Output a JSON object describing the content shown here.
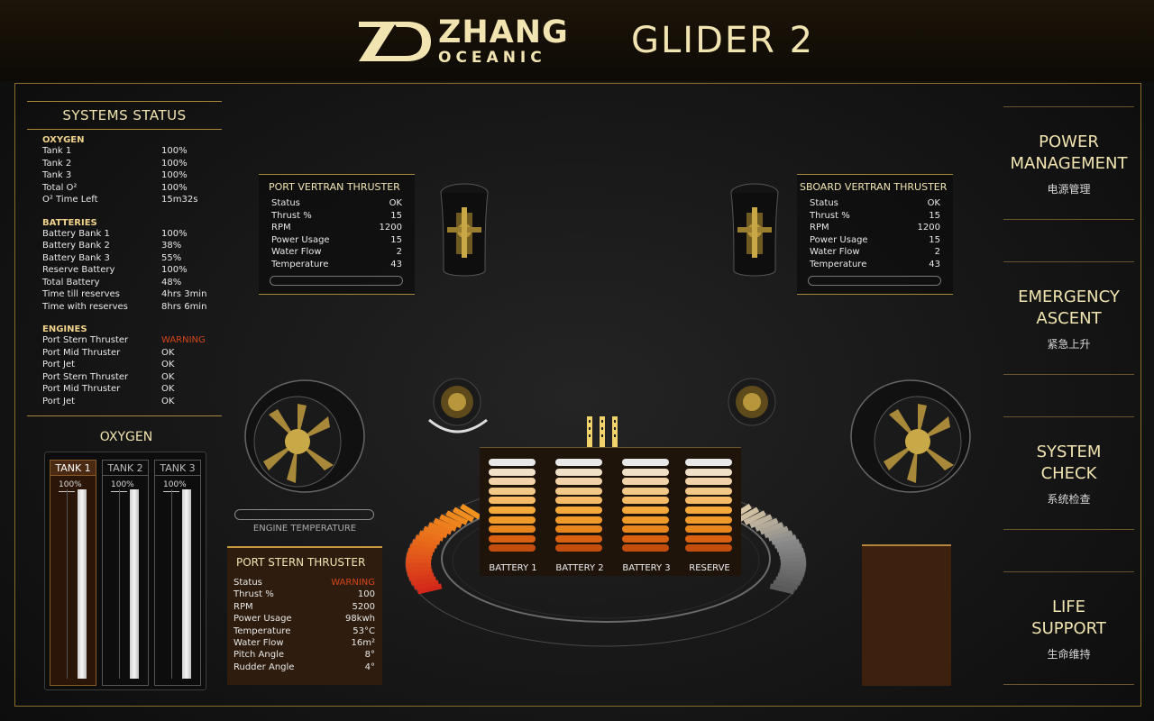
{
  "header": {
    "brand_name": "ZHANG",
    "brand_sub": "OCEANIC",
    "product": "GLIDER 2"
  },
  "systems_status": {
    "title": "SYSTEMS STATUS",
    "oxygen_head": "OXYGEN",
    "oxygen": [
      {
        "k": "Tank 1",
        "v": "100%"
      },
      {
        "k": "Tank 2",
        "v": "100%"
      },
      {
        "k": "Tank 3",
        "v": "100%"
      },
      {
        "k": "Total O²",
        "v": "100%"
      },
      {
        "k": "O² Time Left",
        "v": "15m32s"
      }
    ],
    "batteries_head": "BATTERIES",
    "batteries": [
      {
        "k": "Battery Bank 1",
        "v": "100%"
      },
      {
        "k": "Battery Bank 2",
        "v": "38%"
      },
      {
        "k": "Battery Bank 3",
        "v": "55%"
      },
      {
        "k": "Reserve Battery",
        "v": "100%"
      },
      {
        "k": "Total Battery",
        "v": "48%"
      },
      {
        "k": "Time till reserves",
        "v": "4hrs 3min"
      },
      {
        "k": "Time with reserves",
        "v": "8hrs 6min"
      }
    ],
    "engines_head": "ENGINES",
    "engines": [
      {
        "k": "Port Stern Thruster",
        "v": "WARNING"
      },
      {
        "k": "Port Mid Thruster",
        "v": "OK"
      },
      {
        "k": "Port Jet",
        "v": "OK"
      },
      {
        "k": "Port Stern Thruster",
        "v": "OK"
      },
      {
        "k": "Port Mid Thruster",
        "v": "OK"
      },
      {
        "k": "Port Jet",
        "v": "OK"
      }
    ]
  },
  "oxygen_tanks": {
    "title": "OXYGEN",
    "tanks": [
      {
        "label": "TANK 1",
        "pct": "100%"
      },
      {
        "label": "TANK 2",
        "pct": "100%"
      },
      {
        "label": "TANK 3",
        "pct": "100%"
      }
    ],
    "levels": [
      1.0,
      1.0,
      1.0
    ]
  },
  "port_vertran": {
    "title": "PORT VERTRAN THRUSTER",
    "rows": [
      {
        "k": "Status",
        "v": "OK"
      },
      {
        "k": "Thrust %",
        "v": "15"
      },
      {
        "k": "RPM",
        "v": "1200"
      },
      {
        "k": "Power Usage",
        "v": "15"
      },
      {
        "k": "Water Flow",
        "v": "2"
      },
      {
        "k": "Temperature",
        "v": "43"
      }
    ]
  },
  "sboard_vertran": {
    "title": "SBOARD VERTRAN THRUSTER",
    "rows": [
      {
        "k": "Status",
        "v": "OK"
      },
      {
        "k": "Thrust %",
        "v": "15"
      },
      {
        "k": "RPM",
        "v": "1200"
      },
      {
        "k": "Power Usage",
        "v": "15"
      },
      {
        "k": "Water Flow",
        "v": "2"
      },
      {
        "k": "Temperature",
        "v": "43"
      }
    ]
  },
  "port_stern": {
    "title": "PORT STERN THRUSTER",
    "rows": [
      {
        "k": "Status",
        "v": "WARNING"
      },
      {
        "k": "Thrust %",
        "v": "100"
      },
      {
        "k": "RPM",
        "v": "5200"
      },
      {
        "k": "Power Usage",
        "v": "98kwh"
      },
      {
        "k": "Temperature",
        "v": "53°C"
      },
      {
        "k": "Water Flow",
        "v": "16m²"
      },
      {
        "k": "Pitch Angle",
        "v": "8°"
      },
      {
        "k": "Rudder Angle",
        "v": "4°"
      }
    ]
  },
  "engine_temperature_label": "ENGINE TEMPERATURE",
  "batteries_display": {
    "labels": [
      "BATTERY 1",
      "BATTERY 2",
      "BATTERY 3",
      "RESERVE"
    ]
  },
  "nav": [
    {
      "en1": "POWER",
      "en2": "MANAGEMENT",
      "zh": "电源管理"
    },
    {
      "en1": "EMERGENCY",
      "en2": "ASCENT",
      "zh": "紧急上升"
    },
    {
      "en1": "SYSTEM",
      "en2": "CHECK",
      "zh": "系统检查"
    },
    {
      "en1": "LIFE",
      "en2": "SUPPORT",
      "zh": "生命维持"
    }
  ],
  "colors": {
    "accent": "#f1e4b0",
    "gold": "#a9883e",
    "warning": "#d4441a",
    "battery_segments": [
      "#e8e8e8",
      "#f0e0c8",
      "#f2d2a8",
      "#f4c888",
      "#f6bb66",
      "#f5a93a",
      "#f09a2a",
      "#e7861f",
      "#d86010",
      "#c24d0c"
    ]
  },
  "icons": [
    "zhang-logo-icon",
    "vertran-thruster-icon",
    "stern-thruster-icon",
    "mid-jet-icon",
    "vent-icon"
  ]
}
